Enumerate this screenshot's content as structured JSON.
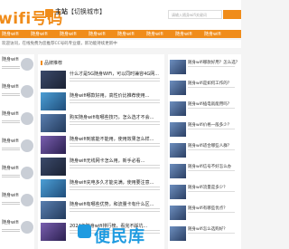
{
  "header": {
    "logo": "wifi号码",
    "station_label": "主站",
    "station_switch": "【切换城市】",
    "search_placeholder": "请输入随身wifi关键词"
  },
  "nav": {
    "items": [
      "随身wifi",
      "随身wifi",
      "随身wifi",
      "随身wifi",
      "随身wifi",
      "随身wifi",
      "随身wifi",
      "随身wifi"
    ]
  },
  "notice": "欢迎访问，在线免费为您推荐CC号码专业版，新功能持续更新中",
  "main": {
    "section_title": "品牌推荐",
    "articles": [
      "什么才是5G随身WiFi，可以同时兼容4G网...",
      "随身wifi哪款好用，高性价比推荐使用...",
      "购买随身wifi有哪些技巧，怎么选才不会...",
      "随身wifi到底能不能用，使用效果怎么样...",
      "随身wifi无线网卡怎么用，新手必看...",
      "随身wifi充电多久才能充满，使用要注意...",
      "随身wifi有哪些优势，和流量卡有什么区...",
      "2024年随身wifi排行榜，看完不踩坑..."
    ]
  },
  "left": {
    "items": [
      "随身wifi",
      "随身wifi",
      "随身wifi",
      "随身wifi",
      "随身wifi",
      "随身wifi",
      "随身wifi"
    ]
  },
  "right": {
    "items": [
      "随身wifi哪款好用？怎么选？",
      "随身wifi是如何工作的？",
      "随身wifi插电就能用吗？",
      "随身wifi价格一般多少？",
      "随身wifi适合哪些人群？",
      "随身wifi信号不好怎么办",
      "随身wifi流量是多少？",
      "随身wifi有哪些优点？",
      "随身wifi怎么选购好？"
    ]
  },
  "watermark": "便民库"
}
